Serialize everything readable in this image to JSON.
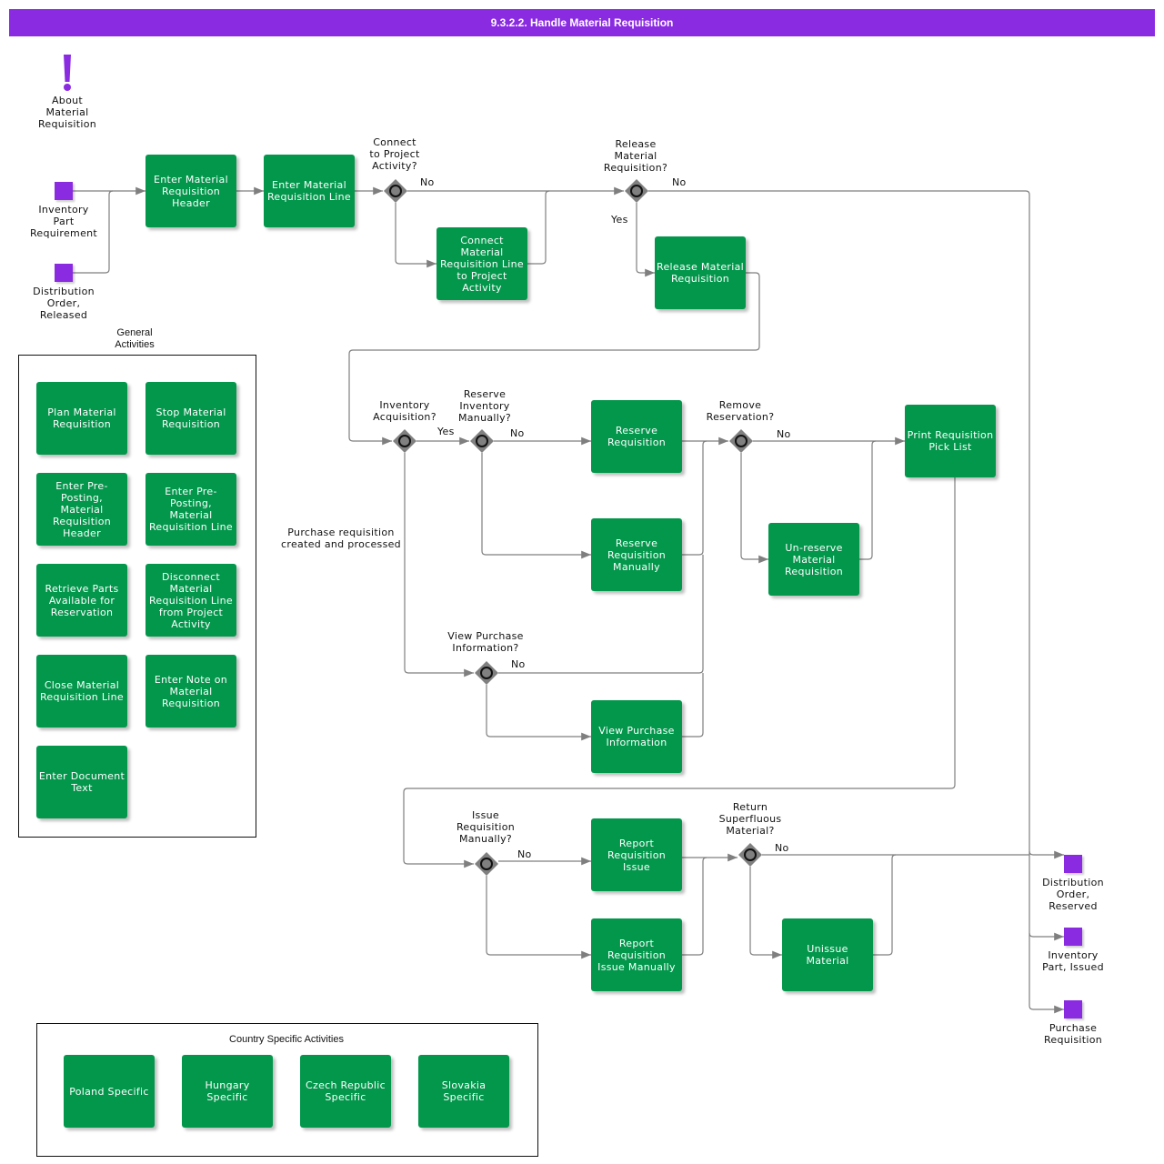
{
  "title": "9.3.2.2. Handle Material Requisition",
  "about": {
    "label": "About\nMaterial\nRequisition",
    "icon": "exclamation-icon"
  },
  "colors": {
    "title_bar": "#8a2be2",
    "task": "#02974b",
    "event": "#8a2be2",
    "gateway": "#808080",
    "flow": "#7f7f7f"
  },
  "start_events": [
    {
      "label": "Inventory\nPart\nRequirement"
    },
    {
      "label": "Distribution\nOrder,\nReleased"
    }
  ],
  "end_events": [
    {
      "label": "Distribution\nOrder,\nReserved"
    },
    {
      "label": "Inventory\nPart, Issued"
    },
    {
      "label": "Purchase\nRequisition"
    }
  ],
  "tasks": {
    "enter_header": "Enter Material Requisition Header",
    "enter_line": "Enter Material Requisition Line",
    "connect_line": "Connect Material Requisition Line to Project Activity",
    "release": "Release Material Requisition",
    "reserve": "Reserve Requisition",
    "reserve_manually": "Reserve Requisition Manually",
    "unreserve": "Un-reserve Material Requisition",
    "print_pick_list": "Print Requisition Pick List",
    "view_purchase": "View Purchase Information",
    "report_issue": "Report Requisition Issue",
    "report_issue_manually": "Report Requisition Issue Manually",
    "unissue": "Unissue Material"
  },
  "gateways": {
    "connect_project": "Connect\nto Project\nActivity?",
    "release": "Release\nMaterial\nRequisition?",
    "inventory_acq": "Inventory\nAcquisition?",
    "reserve_manually": "Reserve\nInventory\nManually?",
    "remove_reservation": "Remove\nReservation?",
    "view_purchase": "View Purchase\nInformation?",
    "issue_manually": "Issue\nRequisition\nManually?",
    "return_superfluous": "Return\nSuperfluous\nMaterial?"
  },
  "flow_labels": {
    "no": "No",
    "yes": "Yes",
    "purchase_note": "Purchase requisition\ncreated and processed"
  },
  "general_activities": {
    "title": "General\nActivities",
    "items": [
      "Plan Material Requisition",
      "Stop Material Requisition",
      "Enter Pre-Posting, Material Requisition Header",
      "Enter Pre-Posting, Material Requisition Line",
      "Retrieve Parts Available for Reservation",
      "Disconnect Material Requisition Line from Project Activity",
      "Close Material Requisition Line",
      "Enter Note on Material Requisition",
      "Enter Document Text"
    ]
  },
  "country_activities": {
    "title": "Country Specific Activities",
    "items": [
      "Poland Specific",
      "Hungary Specific",
      "Czech Republic Specific",
      "Slovakia Specific"
    ]
  }
}
